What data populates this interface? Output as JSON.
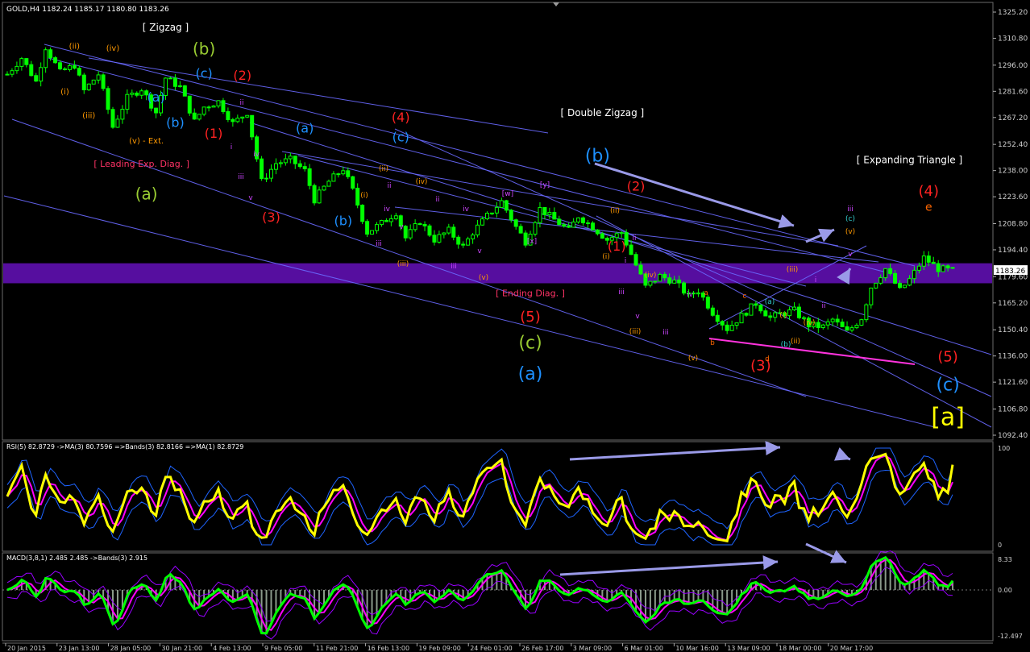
{
  "chart_data": [
    {
      "type": "candlestick",
      "panel": "main",
      "header": "GOLD,H4  1182.24 1185.17 1180.80 1183.26",
      "symbol": "GOLD,H4",
      "ylim": [
        1092.4,
        1325.2
      ],
      "y_ticks": [
        "1325.20",
        "1310.80",
        "1296.00",
        "1281.60",
        "1267.20",
        "1252.40",
        "1238.00",
        "1223.60",
        "1208.80",
        "1194.40",
        "1179.60",
        "1165.20",
        "1150.40",
        "1136.00",
        "1121.60",
        "1106.80",
        "1092.40"
      ],
      "last_price": "1183.26",
      "zone": [
        1176.0,
        1187.0
      ],
      "x_ticks": [
        "20 Jan 2015",
        "23 Jan 13:00",
        "28 Jan 05:00",
        "30 Jan 21:00",
        "4 Feb 13:00",
        "9 Feb 05:00",
        "11 Feb 21:00",
        "16 Feb 13:00",
        "19 Feb 09:00",
        "24 Feb 01:00",
        "26 Feb 17:00",
        "3 Mar 09:00",
        "6 Mar 01:00",
        "10 Mar 16:00",
        "13 Mar 09:00",
        "18 Mar 00:00",
        "20 Mar 17:00"
      ],
      "path": [
        [
          0,
          1291
        ],
        [
          3,
          1300
        ],
        [
          6,
          1287
        ],
        [
          8,
          1306
        ],
        [
          11,
          1292
        ],
        [
          14,
          1296
        ],
        [
          16,
          1282
        ],
        [
          19,
          1291
        ],
        [
          22,
          1262
        ],
        [
          25,
          1278
        ],
        [
          28,
          1283
        ],
        [
          31,
          1270
        ],
        [
          33,
          1289
        ],
        [
          36,
          1284
        ],
        [
          39,
          1265
        ],
        [
          41,
          1273
        ],
        [
          44,
          1276
        ],
        [
          47,
          1264
        ],
        [
          50,
          1270
        ],
        [
          53,
          1232
        ],
        [
          56,
          1242
        ],
        [
          59,
          1244
        ],
        [
          62,
          1238
        ],
        [
          64,
          1222
        ],
        [
          67,
          1232
        ],
        [
          70,
          1239
        ],
        [
          72,
          1227
        ],
        [
          75,
          1204
        ],
        [
          78,
          1209
        ],
        [
          81,
          1215
        ],
        [
          83,
          1201
        ],
        [
          86,
          1210
        ],
        [
          89,
          1200
        ],
        [
          92,
          1205
        ],
        [
          95,
          1196
        ],
        [
          97,
          1204
        ],
        [
          100,
          1213
        ],
        [
          103,
          1221
        ],
        [
          106,
          1207
        ],
        [
          108,
          1199
        ],
        [
          111,
          1217
        ],
        [
          114,
          1211
        ],
        [
          117,
          1205
        ],
        [
          119,
          1213
        ],
        [
          122,
          1207
        ],
        [
          125,
          1200
        ],
        [
          128,
          1204
        ],
        [
          131,
          1186
        ],
        [
          133,
          1174
        ],
        [
          136,
          1180
        ],
        [
          139,
          1177
        ],
        [
          142,
          1169
        ],
        [
          144,
          1172
        ],
        [
          147,
          1160
        ],
        [
          150,
          1151
        ],
        [
          153,
          1158
        ],
        [
          156,
          1165
        ],
        [
          159,
          1157
        ],
        [
          161,
          1159
        ],
        [
          164,
          1161
        ],
        [
          167,
          1153
        ],
        [
          170,
          1152
        ],
        [
          172,
          1156
        ],
        [
          175,
          1149
        ],
        [
          178,
          1157
        ],
        [
          180,
          1174
        ],
        [
          183,
          1184
        ],
        [
          186,
          1172
        ],
        [
          188,
          1178
        ],
        [
          191,
          1190
        ],
        [
          194,
          1184
        ],
        [
          197,
          1183
        ]
      ],
      "n_bars": 198,
      "color_up": "#00ff00",
      "color_down": "#00ff00",
      "annotations": [
        {
          "text": "[ Zigzag ]",
          "x": 33,
          "p": 1315,
          "color": "#ffffff",
          "size": 12
        },
        {
          "text": "(b)",
          "x": 41,
          "p": 1302,
          "color": "#9acd32",
          "size": 20
        },
        {
          "text": "(c)",
          "x": 41,
          "p": 1289,
          "color": "#1e90ff",
          "size": 16
        },
        {
          "text": "(a)",
          "x": 31,
          "p": 1276,
          "color": "#1e90ff",
          "size": 16
        },
        {
          "text": "(b)",
          "x": 35,
          "p": 1262,
          "color": "#1e90ff",
          "size": 16
        },
        {
          "text": "(ii)",
          "x": 14,
          "p": 1305,
          "color": "#ff9900",
          "size": 10
        },
        {
          "text": "(iv)",
          "x": 22,
          "p": 1304,
          "color": "#ff9900",
          "size": 10
        },
        {
          "text": "(i)",
          "x": 12,
          "p": 1280,
          "color": "#ff9900",
          "size": 10
        },
        {
          "text": "(iii)",
          "x": 17,
          "p": 1267,
          "color": "#ff9900",
          "size": 10
        },
        {
          "text": "(v) - Ext.",
          "x": 29,
          "p": 1253,
          "color": "#ff9900",
          "size": 10
        },
        {
          "text": "[ Leading Exp. Diag. ]",
          "x": 28,
          "p": 1240,
          "color": "#ff3366",
          "size": 11
        },
        {
          "text": "(a)",
          "x": 29,
          "p": 1222,
          "color": "#9acd32",
          "size": 20
        },
        {
          "text": "(2)",
          "x": 49,
          "p": 1288,
          "color": "#ff2222",
          "size": 16
        },
        {
          "text": "(1)",
          "x": 43,
          "p": 1256,
          "color": "#ff2222",
          "size": 16
        },
        {
          "text": "(3)",
          "x": 55,
          "p": 1210,
          "color": "#ff2222",
          "size": 16
        },
        {
          "text": "(a)",
          "x": 62,
          "p": 1259,
          "color": "#1e90ff",
          "size": 16
        },
        {
          "text": "(b)",
          "x": 70,
          "p": 1208,
          "color": "#1e90ff",
          "size": 16
        },
        {
          "text": "(4)",
          "x": 82,
          "p": 1265,
          "color": "#ff2222",
          "size": 16
        },
        {
          "text": "(c)",
          "x": 82,
          "p": 1254,
          "color": "#1e90ff",
          "size": 16
        },
        {
          "text": "[ Double Zigzag ]",
          "x": 124,
          "p": 1268,
          "color": "#ffffff",
          "size": 12
        },
        {
          "text": "(b)",
          "x": 123,
          "p": 1243,
          "color": "#1e90ff",
          "size": 22
        },
        {
          "text": "(2)",
          "x": 131,
          "p": 1227,
          "color": "#ff2222",
          "size": 16
        },
        {
          "text": "(1)",
          "x": 127,
          "p": 1194,
          "color": "#ff2222",
          "size": 16
        },
        {
          "text": "[ Ending Diag. ]",
          "x": 109,
          "p": 1169,
          "color": "#ff3366",
          "size": 11
        },
        {
          "text": "(5)",
          "x": 109,
          "p": 1155,
          "color": "#ff2222",
          "size": 18
        },
        {
          "text": "(c)",
          "x": 109,
          "p": 1140,
          "color": "#9acd32",
          "size": 22
        },
        {
          "text": "(a)",
          "x": 109,
          "p": 1123,
          "color": "#1e90ff",
          "size": 22
        },
        {
          "text": "(3)",
          "x": 157,
          "p": 1128,
          "color": "#ff2222",
          "size": 18
        },
        {
          "text": "[ Expanding Triangle ]",
          "x": 188,
          "p": 1242,
          "color": "#ffffff",
          "size": 12
        },
        {
          "text": "(4)",
          "x": 192,
          "p": 1224,
          "color": "#ff2222",
          "size": 18
        },
        {
          "text": "e",
          "x": 192,
          "p": 1216,
          "color": "#ff6600",
          "size": 14
        },
        {
          "text": "(5)",
          "x": 196,
          "p": 1133,
          "color": "#ff2222",
          "size": 18
        },
        {
          "text": "(c)",
          "x": 196,
          "p": 1117,
          "color": "#1e90ff",
          "size": 22
        },
        {
          "text": "[a]",
          "x": 196,
          "p": 1098,
          "color": "#ffff00",
          "size": 30
        }
      ]
    },
    {
      "type": "line",
      "panel": "rsi",
      "header": "RSI(5) 82.8729  ->MA(3) 80.7596  =>Bands(3) 82.8166  =>MA(1) 82.8729",
      "ylim": [
        0,
        100
      ],
      "y_ticks": [
        "100",
        "0"
      ],
      "series": [
        {
          "color": "#ffff00"
        },
        {
          "color": "#ff00ff"
        },
        {
          "color": "#1e64ff"
        }
      ],
      "last": 82.87
    },
    {
      "type": "line",
      "panel": "macd",
      "header": "MACD(3,8,1) 2.485 2.485  ->Bands(3) 2.915",
      "ylim": [
        -12.497,
        8.33
      ],
      "y_ticks": [
        "8.33",
        "0.00",
        "-12.497"
      ],
      "series": [
        {
          "color": "#00ff00"
        },
        {
          "color": "#ff00ff"
        },
        {
          "color": "#9900ff"
        }
      ],
      "last": 2.485
    }
  ]
}
